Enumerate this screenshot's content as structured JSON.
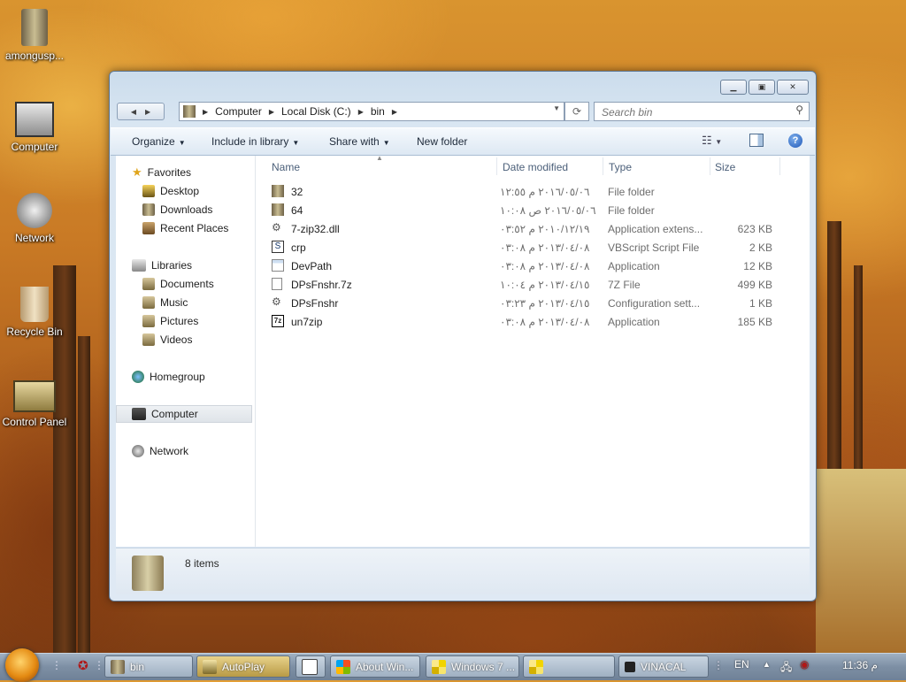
{
  "desktop": {
    "icons": [
      {
        "label": "amongusp...",
        "icon": "archive-icon"
      },
      {
        "label": "Computer",
        "icon": "computer-icon"
      },
      {
        "label": "Network",
        "icon": "network-icon"
      },
      {
        "label": "Recycle Bin",
        "icon": "recycle-bin-icon"
      },
      {
        "label": "Control Panel",
        "icon": "control-panel-icon"
      }
    ]
  },
  "window": {
    "breadcrumb": [
      "Computer",
      "Local Disk (C:)",
      "bin"
    ],
    "search_placeholder": "Search bin",
    "toolbar": {
      "organize": "Organize",
      "include_in_library": "Include in library",
      "share_with": "Share with",
      "new_folder": "New folder"
    },
    "nav": {
      "favorites": "Favorites",
      "desktop": "Desktop",
      "downloads": "Downloads",
      "recent_places": "Recent Places",
      "libraries": "Libraries",
      "documents": "Documents",
      "music": "Music",
      "pictures": "Pictures",
      "videos": "Videos",
      "homegroup": "Homegroup",
      "computer": "Computer",
      "network": "Network"
    },
    "columns": {
      "name": "Name",
      "date_modified": "Date modified",
      "type": "Type",
      "size": "Size"
    },
    "files": [
      {
        "name": "32",
        "date": "٢٠١٦/٠٥/٠٦ م ١٢:٥٥",
        "type": "File folder",
        "size": "",
        "icon": "folder-icon"
      },
      {
        "name": "64",
        "date": "٢٠١٦/٠٥/٠٦ ص ١٠:٠٨",
        "type": "File folder",
        "size": "",
        "icon": "folder-icon"
      },
      {
        "name": "7-zip32.dll",
        "date": "٢٠١٠/١٢/١٩ م ٠٣:٥٢",
        "type": "Application extens...",
        "size": "623 KB",
        "icon": "dll-gear-icon"
      },
      {
        "name": "crp",
        "date": "٢٠١٣/٠٤/٠٨ م ٠٣:٠٨",
        "type": "VBScript Script File",
        "size": "2 KB",
        "icon": "script-icon"
      },
      {
        "name": "DevPath",
        "date": "٢٠١٣/٠٤/٠٨ م ٠٣:٠٨",
        "type": "Application",
        "size": "12 KB",
        "icon": "application-icon"
      },
      {
        "name": "DPsFnshr.7z",
        "date": "٢٠١٣/٠٤/١٥ م ١٠:٠٤",
        "type": "7Z File",
        "size": "499 KB",
        "icon": "file-icon"
      },
      {
        "name": "DPsFnshr",
        "date": "٢٠١٣/٠٤/١٥ م ٠٣:٢٣",
        "type": "Configuration sett...",
        "size": "1 KB",
        "icon": "settings-file-icon"
      },
      {
        "name": "un7zip",
        "date": "٢٠١٣/٠٤/٠٨ م ٠٣:٠٨",
        "type": "Application",
        "size": "185 KB",
        "icon": "7zip-icon"
      }
    ],
    "status": {
      "items": "8 items"
    }
  },
  "taskbar": {
    "buttons": [
      {
        "label": "bin"
      },
      {
        "label": "AutoPlay"
      },
      {
        "label": ""
      },
      {
        "label": "About Win..."
      },
      {
        "label": "Windows 7 ..."
      },
      {
        "label": ""
      },
      {
        "label": "VINACAL"
      }
    ],
    "language": "EN",
    "clock": "11:36 م"
  }
}
